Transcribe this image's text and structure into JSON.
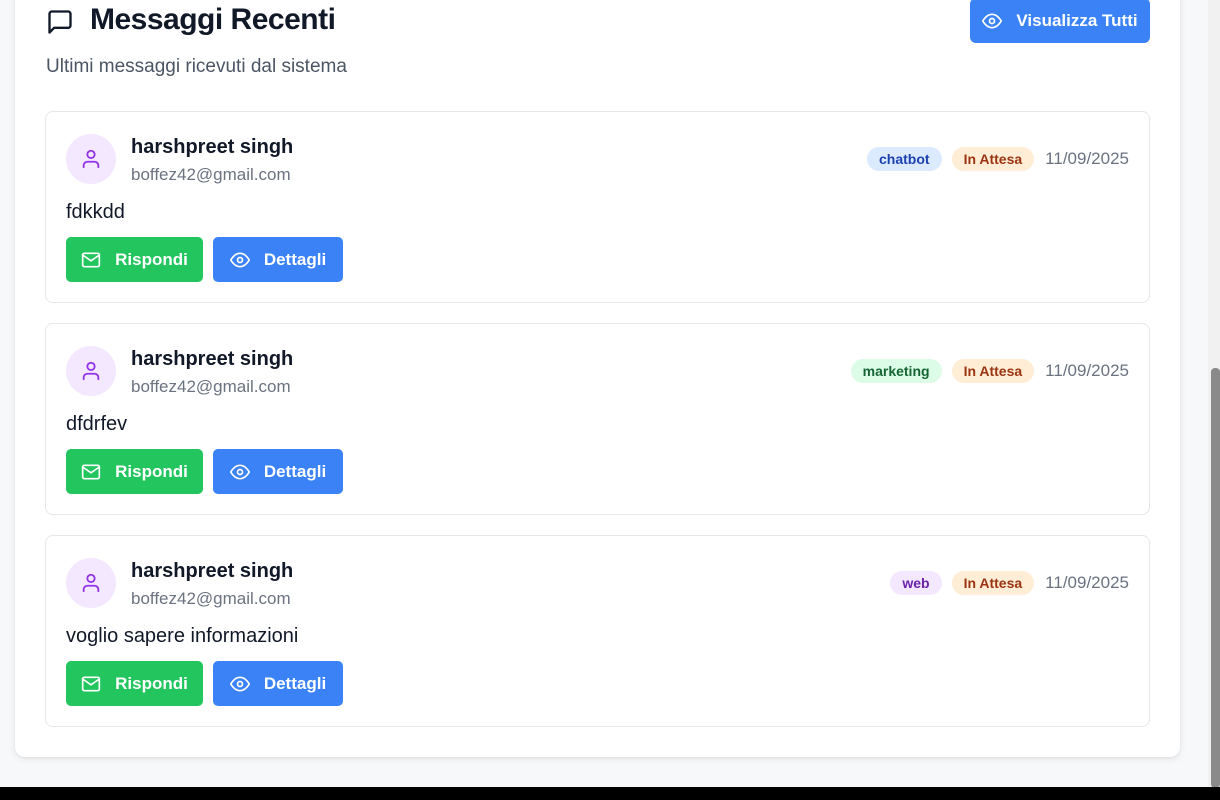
{
  "header": {
    "title": "Messaggi Recenti",
    "subtitle": "Ultimi messaggi ricevuti dal sistema",
    "view_all_label": "Visualizza Tutti",
    "icon": "message-square-icon"
  },
  "messages": [
    {
      "name": "harshpreet singh",
      "email": "boffez42@gmail.com",
      "source": "chatbot",
      "status": "In Attesa",
      "date": "11/09/2025",
      "text": "fdkkdd",
      "reply_label": "Rispondi",
      "details_label": "Dettagli"
    },
    {
      "name": "harshpreet singh",
      "email": "boffez42@gmail.com",
      "source": "marketing",
      "status": "In Attesa",
      "date": "11/09/2025",
      "text": "dfdrfev",
      "reply_label": "Rispondi",
      "details_label": "Dettagli"
    },
    {
      "name": "harshpreet singh",
      "email": "boffez42@gmail.com",
      "source": "web",
      "status": "In Attesa",
      "date": "11/09/2025",
      "text": "voglio sapere informazioni",
      "reply_label": "Rispondi",
      "details_label": "Dettagli"
    }
  ],
  "colors": {
    "primary": "#3b82f6",
    "success": "#22c55e",
    "avatar_bg": "#f3e8ff",
    "status_bg": "#ffedd5"
  }
}
